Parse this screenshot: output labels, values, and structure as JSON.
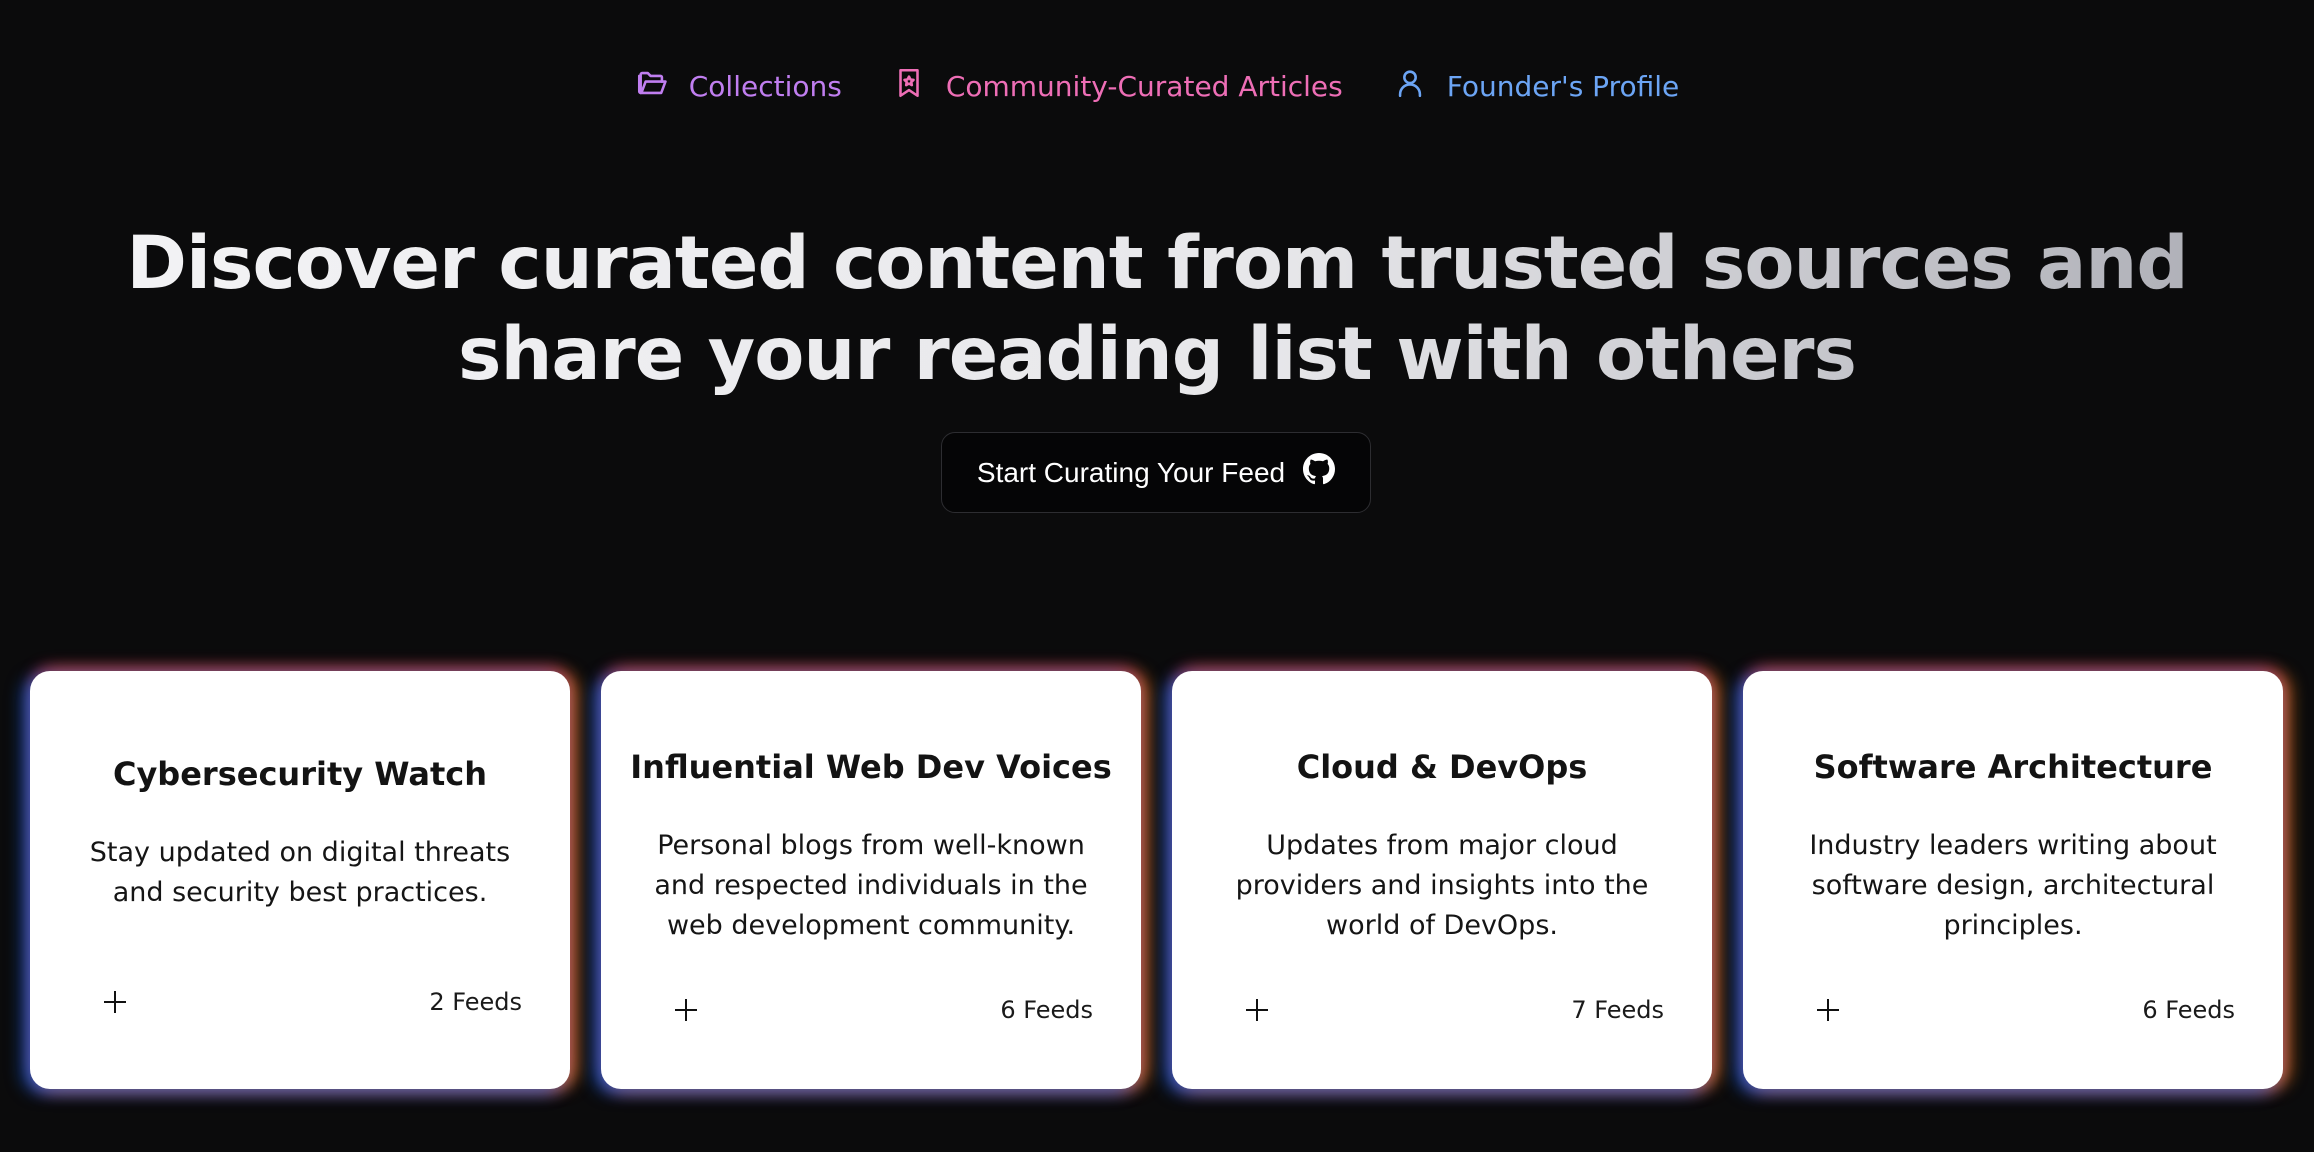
{
  "nav": [
    {
      "label": "Collections",
      "icon": "folder-open-icon",
      "color": "#c07ef0"
    },
    {
      "label": "Community-Curated Articles",
      "icon": "bookmark-icon",
      "color": "#ee6eb6"
    },
    {
      "label": "Founder's Profile",
      "icon": "user-icon",
      "color": "#6ca5f5"
    }
  ],
  "hero": {
    "line1": "Discover curated content from trusted sources and",
    "line2": "share your reading list with others"
  },
  "cta": {
    "label": "Start Curating Your Feed",
    "icon": "github-icon"
  },
  "cards": [
    {
      "title": "Cybersecurity Watch",
      "description": "Stay updated on digital threats and security best practices.",
      "count": "2 Feeds",
      "add_icon": "plus-icon"
    },
    {
      "title": "Influential Web Dev Voices",
      "description": "Personal blogs from well-known and respected individuals in the web development community.",
      "count": "6 Feeds",
      "add_icon": "plus-icon"
    },
    {
      "title": "Cloud & DevOps",
      "description": "Updates from major cloud providers and insights into the world of DevOps.",
      "count": "7 Feeds",
      "add_icon": "plus-icon"
    },
    {
      "title": "Software Architecture",
      "description": "Industry leaders writing about software design, architectural principles.",
      "count": "6 Feeds",
      "add_icon": "plus-icon"
    }
  ]
}
